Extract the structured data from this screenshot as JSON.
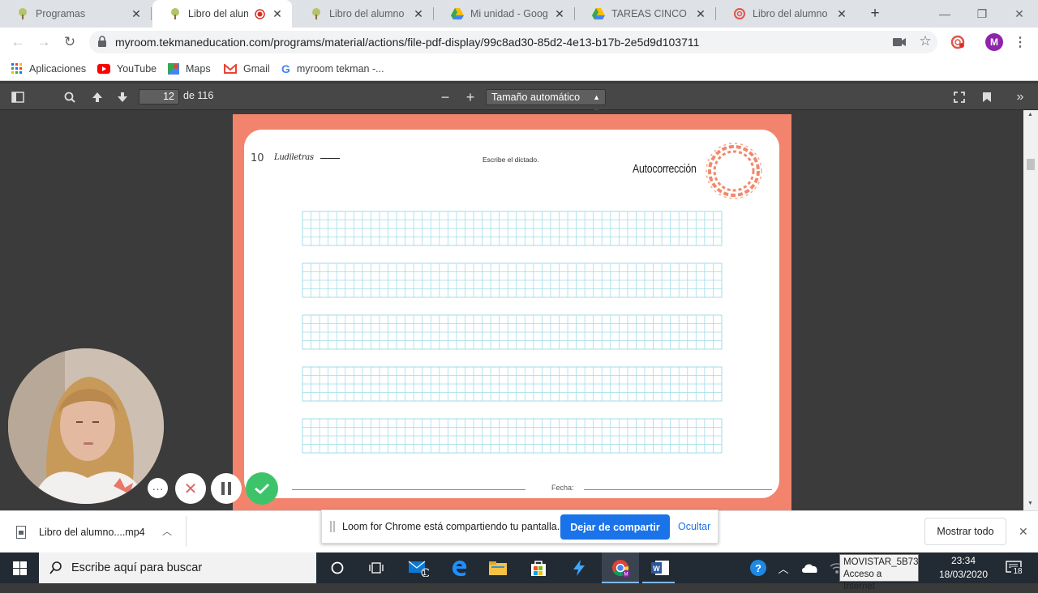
{
  "browser": {
    "tabs": [
      {
        "title": "Programas",
        "favicon": "tekman-tree-icon"
      },
      {
        "title": "Libro del alumno",
        "favicon": "tekman-tree-icon",
        "recording": true
      },
      {
        "title": "Libro del alumno EM",
        "favicon": "tekman-tree-icon"
      },
      {
        "title": "Mi unidad - Google",
        "favicon": "google-drive-icon"
      },
      {
        "title": "TAREAS CINCO AÑO",
        "favicon": "google-drive-icon"
      },
      {
        "title": "Libro del alumno EM",
        "favicon": "loom-icon"
      }
    ],
    "new_tab": "+",
    "url": "myroom.tekmaneducation.com/programs/material/actions/file-pdf-display/99c8ad30-85d2-4e13-b17b-2e5d9d103711",
    "profile_initial": "M"
  },
  "bookmarks": [
    {
      "label": "Aplicaciones",
      "icon": "apps-grid-icon"
    },
    {
      "label": "YouTube",
      "icon": "youtube-icon"
    },
    {
      "label": "Maps",
      "icon": "maps-icon"
    },
    {
      "label": "Gmail",
      "icon": "gmail-icon"
    },
    {
      "label": "myroom tekman -...",
      "icon": "google-icon"
    }
  ],
  "pdf": {
    "page_current": "12",
    "page_total": "de 116",
    "zoom": "Tamaño automático"
  },
  "worksheet": {
    "page_number": "10",
    "brand": "Ludiletras",
    "instruction": "Escribe el dictado.",
    "autocorrection": "Autocorrección",
    "grid_rows": 5,
    "date_label": "Fecha:",
    "border_color": "#f2846d",
    "grid_color": "#9fdcea"
  },
  "download": {
    "file": "Libro del alumno....mp4",
    "show_all": "Mostrar todo"
  },
  "loom": {
    "message": "Loom for Chrome está compartiendo tu pantalla.",
    "stop": "Dejar de compartir",
    "hide": "Ocultar"
  },
  "taskbar": {
    "search_placeholder": "Escribe aquí para buscar",
    "network_name": "MOVISTAR_5B73",
    "network_status": "Acceso a Internet",
    "time": "23:34",
    "date": "18/03/2020",
    "notifications": "18",
    "mail_badge": "1"
  }
}
